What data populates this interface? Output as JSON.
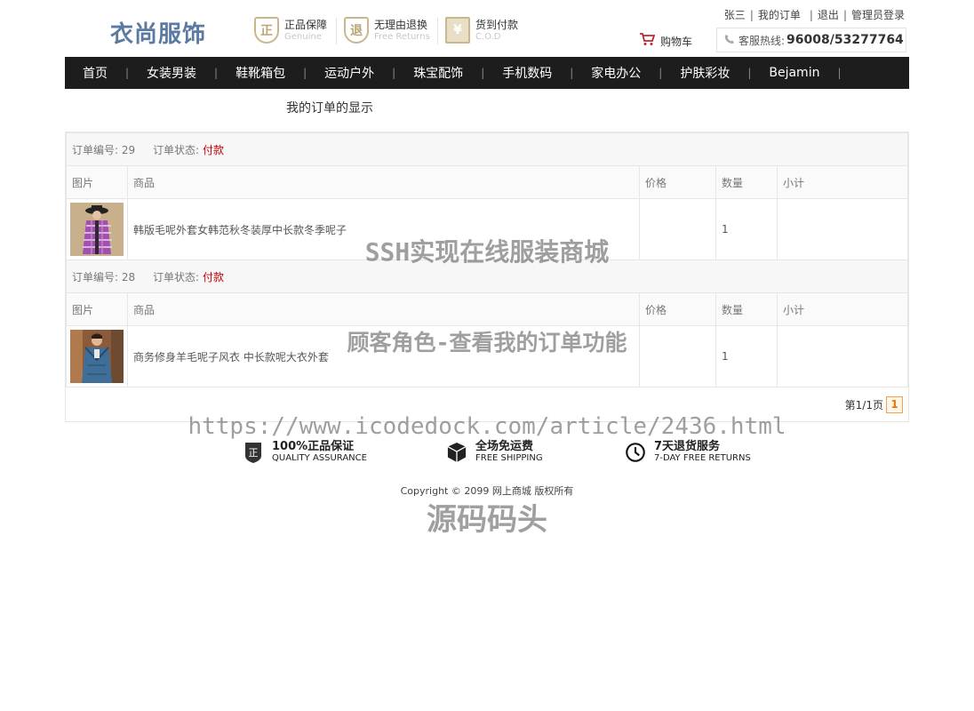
{
  "header": {
    "logo": "衣尚服饰",
    "promos": [
      {
        "icon": "正",
        "title": "正品保障",
        "sub": "Genuine"
      },
      {
        "icon": "退",
        "title": "无理由退换",
        "sub": "Free Returns"
      },
      {
        "icon": "¥",
        "title": "货到付款",
        "sub": "C.O.D"
      }
    ],
    "user_links": [
      "张三",
      "我的订单",
      "退出",
      "管理员登录"
    ],
    "cart_label": "购物车",
    "hotline_label": "客服热线:",
    "hotline_number": "96008/53277764"
  },
  "nav": [
    "首页",
    "女装男装",
    "鞋靴箱包",
    "运动户外",
    "珠宝配饰",
    "手机数码",
    "家电办公",
    "护肤彩妆",
    "Bejamin"
  ],
  "subtitle": "我的订单的显示",
  "orders": [
    {
      "id_label": "订单编号: 29",
      "status_label": "订单状态:",
      "status": "付款",
      "columns": [
        "图片",
        "商品",
        "价格",
        "数量",
        "小计"
      ],
      "item": {
        "name": "韩版毛呢外套女韩范秋冬装厚中长款冬季呢子",
        "price": "",
        "qty": "1",
        "subtotal": ""
      }
    },
    {
      "id_label": "订单编号: 28",
      "status_label": "订单状态:",
      "status": "付款",
      "columns": [
        "图片",
        "商品",
        "价格",
        "数量",
        "小计"
      ],
      "item": {
        "name": "商务修身羊毛呢子风衣 中长款呢大衣外套",
        "price": "",
        "qty": "1",
        "subtotal": ""
      }
    }
  ],
  "pager": {
    "text": "第1/1页",
    "current": "1"
  },
  "services": [
    {
      "icon": "shield-icon",
      "title": "100%正品保证",
      "sub": "QUALITY ASSURANCE"
    },
    {
      "icon": "box-icon",
      "title": "全场免运费",
      "sub": "FREE SHIPPING"
    },
    {
      "icon": "clock-icon",
      "title": "7天退货服务",
      "sub": "7-DAY FREE RETURNS"
    }
  ],
  "copyright": "Copyright © 2099 网上商城 版权所有",
  "watermarks": [
    "SSH实现在线服装商城",
    "顾客角色-查看我的订单功能",
    "https://www.icodedock.com/article/2436.html",
    "源码码头"
  ],
  "colors": {
    "nav_bg": "#1d1d1d",
    "status_red": "#c40000",
    "logo_blue": "#5b7aa3",
    "pager_orange": "#e57a10"
  }
}
